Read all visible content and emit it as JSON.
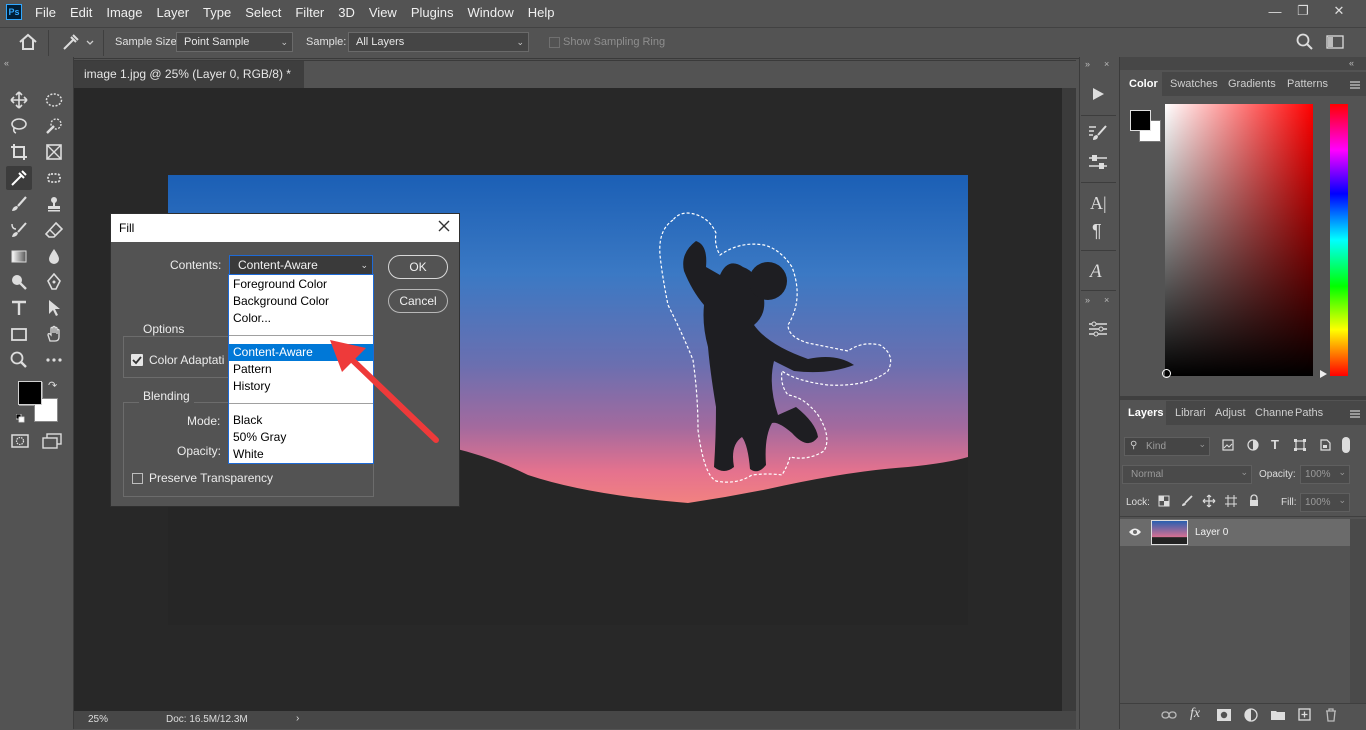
{
  "app": {
    "logo": "Ps",
    "menu": [
      "File",
      "Edit",
      "Image",
      "Layer",
      "Type",
      "Select",
      "Filter",
      "3D",
      "View",
      "Plugins",
      "Window",
      "Help"
    ]
  },
  "options_bar": {
    "sample_size_label": "Sample Size:",
    "sample_size_value": "Point Sample",
    "sample_label": "Sample:",
    "sample_value": "All Layers",
    "show_ring_label": "Show Sampling Ring"
  },
  "document": {
    "tab_title": "image 1.jpg @ 25% (Layer 0, RGB/8) *",
    "zoom": "25%",
    "doc_size": "Doc: 16.5M/12.3M"
  },
  "dialog": {
    "title": "Fill",
    "contents_label": "Contents:",
    "contents_value": "Content-Aware",
    "ok_label": "OK",
    "cancel_label": "Cancel",
    "options_group": "Options",
    "color_adaptation_label": "Color Adaptati",
    "blending_group": "Blending",
    "mode_label": "Mode:",
    "opacity_label": "Opacity:",
    "preserve_label": "Preserve Transparency",
    "dropdown_items": [
      "Foreground Color",
      "Background Color",
      "Color...",
      "Content-Aware",
      "Pattern",
      "History",
      "Black",
      "50% Gray",
      "White"
    ],
    "selected_item": "Content-Aware"
  },
  "color_panel": {
    "tabs": [
      "Color",
      "Swatches",
      "Gradients",
      "Patterns"
    ],
    "active_tab": "Color",
    "foreground": "#000000",
    "background": "#ffffff",
    "hue": "#ff0000"
  },
  "layers_panel": {
    "tabs": [
      "Layers",
      "Librari",
      "Adjust",
      "Channe",
      "Paths"
    ],
    "active_tab": "Layers",
    "kind_label": "Kind",
    "blend_mode": "Normal",
    "opacity_label": "Opacity:",
    "opacity_value": "100%",
    "lock_label": "Lock:",
    "fill_label": "Fill:",
    "fill_value": "100%",
    "layers": [
      {
        "name": "Layer 0",
        "visible": true
      }
    ]
  }
}
